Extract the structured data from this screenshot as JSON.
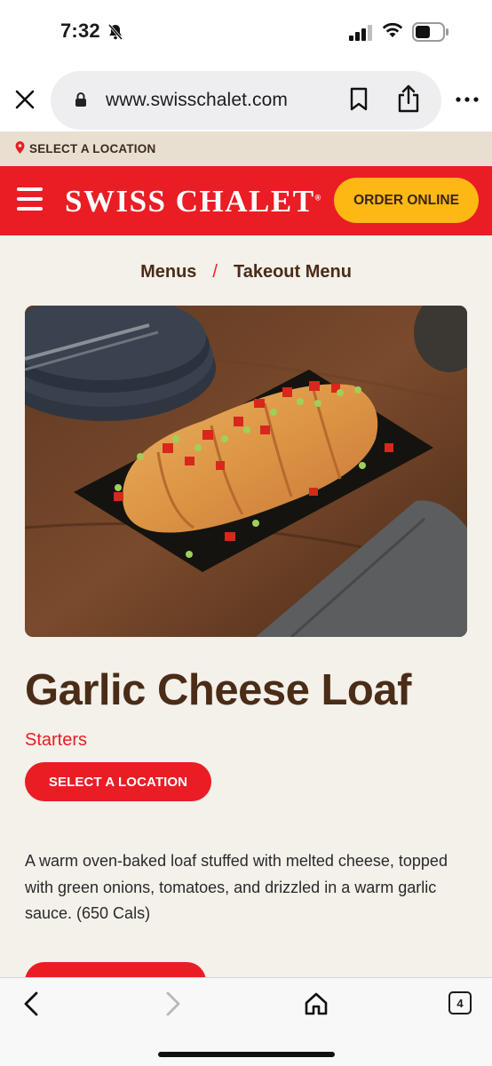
{
  "status_bar": {
    "time": "7:32"
  },
  "browser": {
    "url": "www.swisschalet.com",
    "tab_count": "4"
  },
  "location_bar": {
    "label": "SELECT A LOCATION"
  },
  "header": {
    "logo": "SWISS CHALET",
    "logo_mark": "®",
    "order_button": "ORDER ONLINE",
    "colors": {
      "brand_red": "#ea1d25",
      "order_yellow": "#fdb813"
    }
  },
  "breadcrumb": {
    "items": [
      "Menus",
      "Takeout Menu"
    ],
    "separator": "/"
  },
  "product": {
    "image_icon": "garlic-cheese-loaf-photo",
    "title": "Garlic Cheese Loaf",
    "category": "Starters",
    "select_location_button": "SELECT A LOCATION",
    "description": "A warm oven-baked loaf stuffed with melted cheese, topped with green onions, tomatoes, and drizzled in a warm garlic sauce.  (650 Cals)"
  }
}
